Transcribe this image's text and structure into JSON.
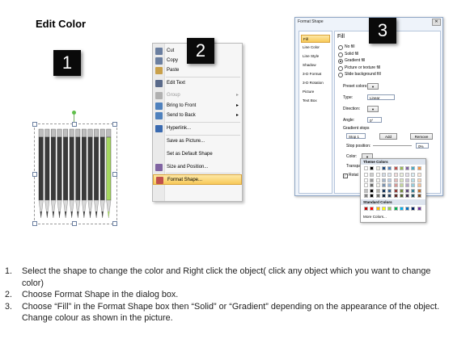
{
  "title": "Edit Color",
  "steps": {
    "one": "1",
    "two": "2",
    "three": "3"
  },
  "pencil_colors": [
    "#3a3a3a",
    "#3a3a3a",
    "#3a3a3a",
    "#3a3a3a",
    "#3a3a3a",
    "#3a3a3a",
    "#3a3a3a",
    "#3a3a3a",
    "#3a3a3a",
    "#3a3a3a",
    "#3a3a3a",
    "#a4d65e"
  ],
  "context_menu": {
    "items": [
      {
        "label": "Cut",
        "icon": "scissors-icon",
        "disabled": false,
        "submenu": false,
        "highlight": false
      },
      {
        "label": "Copy",
        "icon": "copy-icon",
        "disabled": false,
        "submenu": false,
        "highlight": false
      },
      {
        "label": "Paste",
        "icon": "paste-icon",
        "disabled": false,
        "submenu": false,
        "highlight": false
      },
      {
        "label": "Edit Text",
        "icon": "edit-text-icon",
        "disabled": false,
        "submenu": false,
        "highlight": false
      },
      {
        "label": "Group",
        "icon": "group-icon",
        "disabled": true,
        "submenu": true,
        "highlight": false
      },
      {
        "label": "Bring to Front",
        "icon": "bring-front-icon",
        "disabled": false,
        "submenu": true,
        "highlight": false
      },
      {
        "label": "Send to Back",
        "icon": "send-back-icon",
        "disabled": false,
        "submenu": true,
        "highlight": false
      },
      {
        "label": "Hyperlink...",
        "icon": "hyperlink-icon",
        "disabled": false,
        "submenu": false,
        "highlight": false
      },
      {
        "label": "Save as Picture...",
        "icon": "",
        "disabled": false,
        "submenu": false,
        "highlight": false
      },
      {
        "label": "Set as Default Shape",
        "icon": "",
        "disabled": false,
        "submenu": false,
        "highlight": false
      },
      {
        "label": "Size and Position...",
        "icon": "size-position-icon",
        "disabled": false,
        "submenu": false,
        "highlight": false
      },
      {
        "label": "Format Shape...",
        "icon": "format-shape-icon",
        "disabled": false,
        "submenu": false,
        "highlight": true
      }
    ]
  },
  "format_dialog": {
    "title": "Format Shape",
    "nav": [
      "Fill",
      "Line Color",
      "Line Style",
      "Shadow",
      "3-D Format",
      "3-D Rotation",
      "Picture",
      "Text Box"
    ],
    "section": "Fill",
    "options": [
      "No fill",
      "Solid fill",
      "Gradient fill",
      "Picture or texture fill",
      "Slide background fill"
    ],
    "selected_option": "Gradient fill",
    "preset_label": "Preset colors:",
    "type_label": "Type:",
    "type_value": "Linear",
    "direction_label": "Direction:",
    "angle_label": "Angle:",
    "angle_value": "0°",
    "stops_label": "Gradient stops",
    "stop_value": "Stop 1",
    "add_label": "Add",
    "remove_label": "Remove",
    "stop_position_label": "Stop position:",
    "stop_position_value": "0%",
    "color_label": "Color:",
    "transparency_label": "Transpa",
    "rotate_label": "Rotat"
  },
  "palette": {
    "theme_label": "Theme Colors",
    "standard_label": "Standard Colors",
    "more_label": "More Colors...",
    "theme_top": [
      "#ffffff",
      "#000000",
      "#eeece1",
      "#1f497d",
      "#4f81bd",
      "#c0504d",
      "#9bbb59",
      "#8064a2",
      "#4bacc6",
      "#f79646"
    ],
    "standard": [
      "#c00000",
      "#ff0000",
      "#ffc000",
      "#ffff00",
      "#92d050",
      "#00b050",
      "#00b0f0",
      "#0070c0",
      "#002060",
      "#7030a0"
    ]
  },
  "instructions": [
    {
      "num": "1.",
      "text": "Select the shape to change the color and Right click the object( click any object which you want to change color)"
    },
    {
      "num": "2.",
      "text": "Choose Format Shape in the dialog box."
    },
    {
      "num": "3.",
      "text": "Choose “Fill” in the Format Shape box then “Solid” or “Gradient” depending on the appearance of the object. Change colour as shown in the picture."
    }
  ]
}
